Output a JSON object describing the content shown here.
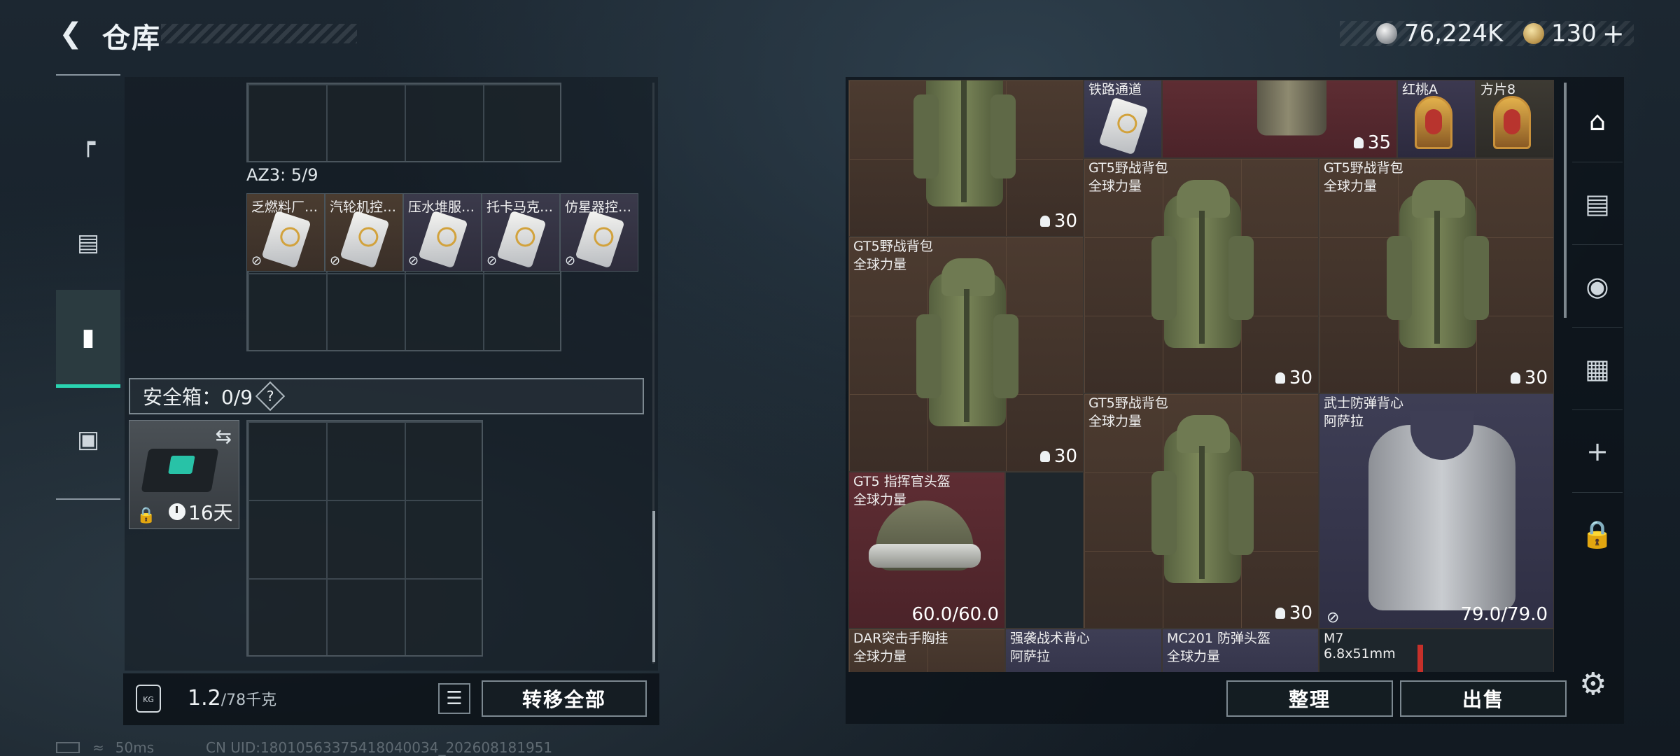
{
  "header": {
    "title": "仓库",
    "currency_silver": "76,224K",
    "currency_gold": "130",
    "add_label": "+"
  },
  "left_rail": {
    "items": [
      {
        "icon": "gun-icon"
      },
      {
        "icon": "armor-icon"
      },
      {
        "icon": "backpack-icon",
        "active": true
      },
      {
        "icon": "briefcase-icon"
      }
    ]
  },
  "left_panel": {
    "az_label": "AZ3: 5/9",
    "az_items": [
      "乏燃料厂…",
      "汽轮机控…",
      "压水堆服…",
      "托卡马克…",
      "仿星器控…"
    ],
    "safe_box_label": "安全箱：0/9",
    "help_label": "?",
    "case_timer": "16天",
    "weight_value": "1.2",
    "weight_max": "/78千克",
    "kg_label": "KG",
    "transfer_all_label": "转移全部"
  },
  "right_panel": {
    "items": [
      {
        "name": "铁路通道",
        "sub": ""
      },
      {
        "name": "红桃A",
        "sub": ""
      },
      {
        "name": "方片8",
        "sub": ""
      },
      {
        "name": "GT5野战背包",
        "sub": "全球力量",
        "count": "30"
      },
      {
        "name": "GT5野战背包",
        "sub": "全球力量",
        "count": "30"
      },
      {
        "name": "GT5野战背包",
        "sub": "全球力量",
        "count": "30"
      },
      {
        "name": "GT5野战背包",
        "sub": "全球力量",
        "count": "30"
      },
      {
        "name": "GT5野战背包",
        "sub": "全球力量",
        "count": "30"
      },
      {
        "name": "武士防弹背心",
        "sub": "阿萨拉",
        "durability": "79.0/79.0"
      },
      {
        "name": "GT5 指挥官头盔",
        "sub": "全球力量",
        "durability": "60.0/60.0"
      },
      {
        "name": "DAR突击手胸挂",
        "sub": "全球力量"
      },
      {
        "name": "强袭战术背心",
        "sub": "阿萨拉"
      },
      {
        "name": "MC201 防弹头盔",
        "sub": "全球力量"
      },
      {
        "name": "M7",
        "sub": "6.8x51mm"
      }
    ],
    "top_counts": [
      "30",
      "35"
    ],
    "sort_label": "整理",
    "sell_label": "出售"
  },
  "right_tabs": [
    "warehouse-icon",
    "tab-IV-plus-icon",
    "tab-V-icon",
    "tab-IV-icon",
    "add-icon",
    "lock-icon"
  ],
  "status": {
    "ping": "50ms",
    "uid": "CN UID:18010563375418040034_202608181951"
  }
}
